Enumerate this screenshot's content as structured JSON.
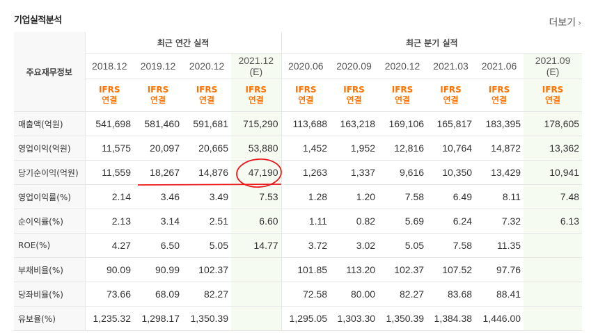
{
  "section_title": "기업실적분석",
  "more_label": "더보기",
  "annual_group": "최근 연간 실적",
  "quarter_group": "최근 분기 실적",
  "row_header": "주요재무정보",
  "columns": [
    {
      "date": "2018.12",
      "est": "",
      "std1": "IFRS",
      "std2": "연결"
    },
    {
      "date": "2019.12",
      "est": "",
      "std1": "IFRS",
      "std2": "연결"
    },
    {
      "date": "2020.12",
      "est": "",
      "std1": "IFRS",
      "std2": "연결"
    },
    {
      "date": "2021.12",
      "est": "(E)",
      "std1": "IFRS",
      "std2": "연결"
    },
    {
      "date": "2020.06",
      "est": "",
      "std1": "IFRS",
      "std2": "연결"
    },
    {
      "date": "2020.09",
      "est": "",
      "std1": "IFRS",
      "std2": "연결"
    },
    {
      "date": "2020.12",
      "est": "",
      "std1": "IFRS",
      "std2": "연결"
    },
    {
      "date": "2021.03",
      "est": "",
      "std1": "IFRS",
      "std2": "연결"
    },
    {
      "date": "2021.06",
      "est": "",
      "std1": "IFRS",
      "std2": "연결"
    },
    {
      "date": "2021.09",
      "est": "(E)",
      "std1": "IFRS",
      "std2": "연결"
    }
  ],
  "rows": [
    {
      "label": "매출액(억원)",
      "values": [
        "541,698",
        "581,460",
        "591,681",
        "715,290",
        "113,688",
        "163,218",
        "169,106",
        "165,817",
        "183,395",
        "178,605"
      ]
    },
    {
      "label": "영업이익(억원)",
      "values": [
        "11,575",
        "20,097",
        "20,665",
        "53,880",
        "1,452",
        "1,952",
        "12,816",
        "10,764",
        "14,872",
        "13,362"
      ]
    },
    {
      "label": "당기순이익(억원)",
      "values": [
        "11,559",
        "18,267",
        "14,876",
        "47,190",
        "1,263",
        "1,337",
        "9,616",
        "10,350",
        "13,429",
        "10,941"
      ]
    },
    {
      "label": "영업이익률(%)",
      "values": [
        "2.14",
        "3.46",
        "3.49",
        "7.53",
        "1.28",
        "1.20",
        "7.58",
        "6.49",
        "8.11",
        "7.48"
      ]
    },
    {
      "label": "순이익률(%)",
      "values": [
        "2.13",
        "3.14",
        "2.51",
        "6.60",
        "1.11",
        "0.82",
        "5.69",
        "6.24",
        "7.32",
        "6.13"
      ]
    },
    {
      "label": "ROE(%)",
      "values": [
        "4.27",
        "6.50",
        "5.05",
        "14.77",
        "3.72",
        "3.02",
        "5.05",
        "7.58",
        "11.35",
        ""
      ]
    },
    {
      "label": "부채비율(%)",
      "values": [
        "90.09",
        "90.99",
        "102.37",
        "",
        "101.85",
        "113.20",
        "102.37",
        "107.52",
        "97.76",
        ""
      ]
    },
    {
      "label": "당좌비율(%)",
      "values": [
        "73.66",
        "68.09",
        "82.27",
        "",
        "72.58",
        "80.00",
        "82.27",
        "83.68",
        "88.41",
        ""
      ]
    },
    {
      "label": "유보율(%)",
      "values": [
        "1,235.32",
        "1,298.17",
        "1,350.39",
        "",
        "1,295.05",
        "1,303.30",
        "1,350.39",
        "1,384.38",
        "1,446.00",
        ""
      ]
    }
  ],
  "annotation_color": "#e8191d",
  "estimate_text_color": "#6a9f44",
  "accounting_color": "#ff7200"
}
